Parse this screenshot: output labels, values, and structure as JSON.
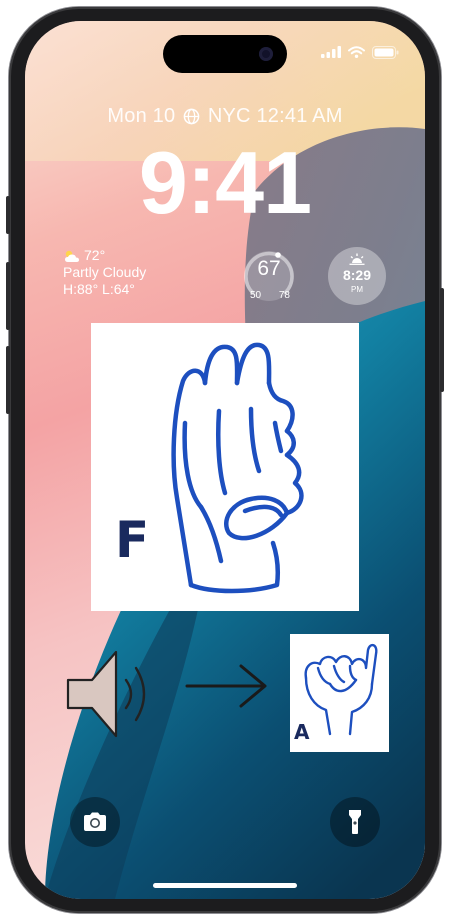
{
  "status_bar": {
    "signal_icon": "cellular-signal-icon",
    "wifi_icon": "wifi-icon",
    "battery_icon": "battery-icon"
  },
  "lock_screen": {
    "date_text": "Mon 10",
    "location": "NYC",
    "clock_small": "12:41 AM",
    "globe_icon": "globe-icon",
    "time": "9:41"
  },
  "widgets": {
    "weather": {
      "icon": "partly-cloudy-icon",
      "temperature": "72°",
      "condition": "Partly Cloudy",
      "high_low": "H:88° L:64°"
    },
    "gauge": {
      "value": "67",
      "low": "50",
      "high": "78"
    },
    "sunset": {
      "icon": "sunset-icon",
      "time": "8:29",
      "period": "PM"
    }
  },
  "content": {
    "sign_large": {
      "letter": "F",
      "icon": "asl-hand-f-icon"
    },
    "speaker_icon": "speaker-icon",
    "arrow_icon": "arrow-right-icon",
    "sign_small": {
      "letter": "A",
      "icon": "asl-hand-a-icon"
    }
  },
  "quick_actions": {
    "camera_icon": "camera-icon",
    "flashlight_icon": "flashlight-icon"
  },
  "colors": {
    "sign_ink": "#1d4fbf",
    "letter_ink": "#1a2a5e",
    "wallpaper_dark": "#0d3d5c",
    "wallpaper_teal": "#1b90b0"
  }
}
